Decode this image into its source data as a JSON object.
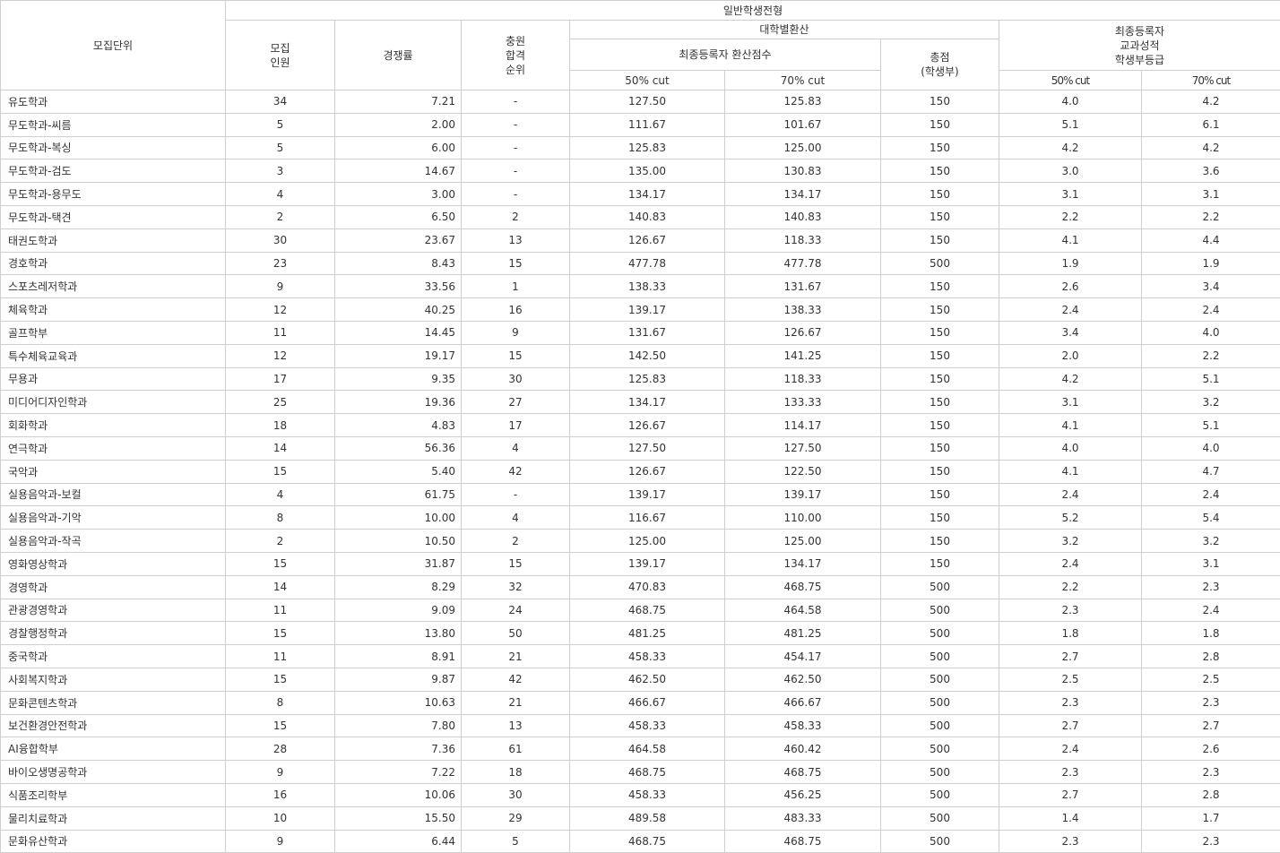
{
  "header": {
    "unit": "모집단위",
    "general": "일반학생전형",
    "recruit": "모집\n인원",
    "ratio": "경쟁률",
    "rank": "충원\n합격\n순위",
    "univ_calc": "대학별환산",
    "final_score": "최종등록자 환산점수",
    "total": "총점\n(학생부)",
    "final_grade": "최종등록자\n교과성적\n학생부등급",
    "cut50": "50% cut",
    "cut70": "70% cut",
    "grade50": "50% cut",
    "grade70": "70% cut"
  },
  "rows": [
    [
      "유도학과",
      "34",
      "7.21",
      "-",
      "127.50",
      "125.83",
      "150",
      "4.0",
      "4.2"
    ],
    [
      "무도학과-씨름",
      "5",
      "2.00",
      "-",
      "111.67",
      "101.67",
      "150",
      "5.1",
      "6.1"
    ],
    [
      "무도학과-복싱",
      "5",
      "6.00",
      "-",
      "125.83",
      "125.00",
      "150",
      "4.2",
      "4.2"
    ],
    [
      "무도학과-검도",
      "3",
      "14.67",
      "-",
      "135.00",
      "130.83",
      "150",
      "3.0",
      "3.6"
    ],
    [
      "무도학과-용무도",
      "4",
      "3.00",
      "-",
      "134.17",
      "134.17",
      "150",
      "3.1",
      "3.1"
    ],
    [
      "무도학과-택견",
      "2",
      "6.50",
      "2",
      "140.83",
      "140.83",
      "150",
      "2.2",
      "2.2"
    ],
    [
      "태권도학과",
      "30",
      "23.67",
      "13",
      "126.67",
      "118.33",
      "150",
      "4.1",
      "4.4"
    ],
    [
      "경호학과",
      "23",
      "8.43",
      "15",
      "477.78",
      "477.78",
      "500",
      "1.9",
      "1.9"
    ],
    [
      "스포츠레저학과",
      "9",
      "33.56",
      "1",
      "138.33",
      "131.67",
      "150",
      "2.6",
      "3.4"
    ],
    [
      "체육학과",
      "12",
      "40.25",
      "16",
      "139.17",
      "138.33",
      "150",
      "2.4",
      "2.4"
    ],
    [
      "골프학부",
      "11",
      "14.45",
      "9",
      "131.67",
      "126.67",
      "150",
      "3.4",
      "4.0"
    ],
    [
      "특수체육교육과",
      "12",
      "19.17",
      "15",
      "142.50",
      "141.25",
      "150",
      "2.0",
      "2.2"
    ],
    [
      "무용과",
      "17",
      "9.35",
      "30",
      "125.83",
      "118.33",
      "150",
      "4.2",
      "5.1"
    ],
    [
      "미디어디자인학과",
      "25",
      "19.36",
      "27",
      "134.17",
      "133.33",
      "150",
      "3.1",
      "3.2"
    ],
    [
      "회화학과",
      "18",
      "4.83",
      "17",
      "126.67",
      "114.17",
      "150",
      "4.1",
      "5.1"
    ],
    [
      "연극학과",
      "14",
      "56.36",
      "4",
      "127.50",
      "127.50",
      "150",
      "4.0",
      "4.0"
    ],
    [
      "국악과",
      "15",
      "5.40",
      "42",
      "126.67",
      "122.50",
      "150",
      "4.1",
      "4.7"
    ],
    [
      "실용음악과-보컬",
      "4",
      "61.75",
      "-",
      "139.17",
      "139.17",
      "150",
      "2.4",
      "2.4"
    ],
    [
      "실용음악과-기악",
      "8",
      "10.00",
      "4",
      "116.67",
      "110.00",
      "150",
      "5.2",
      "5.4"
    ],
    [
      "실용음악과-작곡",
      "2",
      "10.50",
      "2",
      "125.00",
      "125.00",
      "150",
      "3.2",
      "3.2"
    ],
    [
      "영화영상학과",
      "15",
      "31.87",
      "15",
      "139.17",
      "134.17",
      "150",
      "2.4",
      "3.1"
    ],
    [
      "경영학과",
      "14",
      "8.29",
      "32",
      "470.83",
      "468.75",
      "500",
      "2.2",
      "2.3"
    ],
    [
      "관광경영학과",
      "11",
      "9.09",
      "24",
      "468.75",
      "464.58",
      "500",
      "2.3",
      "2.4"
    ],
    [
      "경찰행정학과",
      "15",
      "13.80",
      "50",
      "481.25",
      "481.25",
      "500",
      "1.8",
      "1.8"
    ],
    [
      "중국학과",
      "11",
      "8.91",
      "21",
      "458.33",
      "454.17",
      "500",
      "2.7",
      "2.8"
    ],
    [
      "사회복지학과",
      "15",
      "9.87",
      "42",
      "462.50",
      "462.50",
      "500",
      "2.5",
      "2.5"
    ],
    [
      "문화콘텐츠학과",
      "8",
      "10.63",
      "21",
      "466.67",
      "466.67",
      "500",
      "2.3",
      "2.3"
    ],
    [
      "보건환경안전학과",
      "15",
      "7.80",
      "13",
      "458.33",
      "458.33",
      "500",
      "2.7",
      "2.7"
    ],
    [
      "AI융합학부",
      "28",
      "7.36",
      "61",
      "464.58",
      "460.42",
      "500",
      "2.4",
      "2.6"
    ],
    [
      "바이오생명공학과",
      "9",
      "7.22",
      "18",
      "468.75",
      "468.75",
      "500",
      "2.3",
      "2.3"
    ],
    [
      "식품조리학부",
      "16",
      "10.06",
      "30",
      "458.33",
      "456.25",
      "500",
      "2.7",
      "2.8"
    ],
    [
      "물리치료학과",
      "10",
      "15.50",
      "29",
      "489.58",
      "483.33",
      "500",
      "1.4",
      "1.7"
    ],
    [
      "문화유산학과",
      "9",
      "6.44",
      "5",
      "468.75",
      "468.75",
      "500",
      "2.3",
      "2.3"
    ]
  ]
}
